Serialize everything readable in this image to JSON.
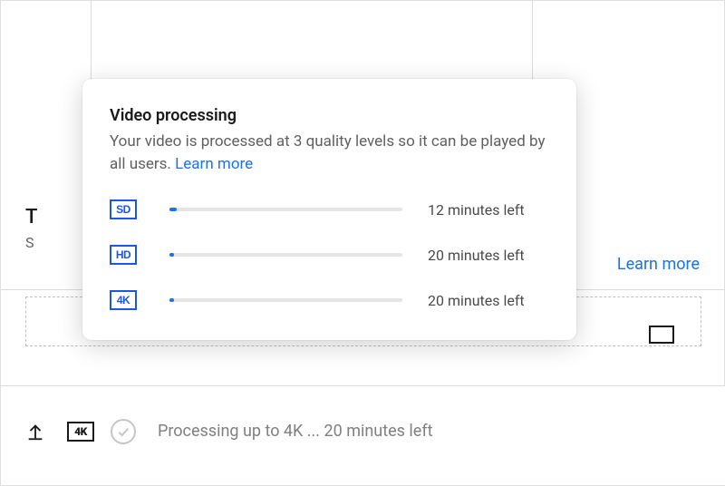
{
  "popover": {
    "heading": "Video processing",
    "description": "Your video is processed at 3 quality levels so it can be played by all users. ",
    "learn_more": "Learn more",
    "qualities": [
      {
        "badge": "SD",
        "progress_pct": 3,
        "time_left": "12 minutes left"
      },
      {
        "badge": "HD",
        "progress_pct": 2,
        "time_left": "20 minutes left"
      },
      {
        "badge": "4K",
        "progress_pct": 2,
        "time_left": "20 minutes left"
      }
    ]
  },
  "background": {
    "title_fragment": "T",
    "subtitle_fragment": "S",
    "learn_more": "Learn more"
  },
  "status_bar": {
    "badge": "4K",
    "text": "Processing up to 4K ... 20 minutes left"
  },
  "colors": {
    "link_blue": "#1a73e8",
    "brand_blue": "#1a57e8",
    "text_muted": "#606060"
  }
}
